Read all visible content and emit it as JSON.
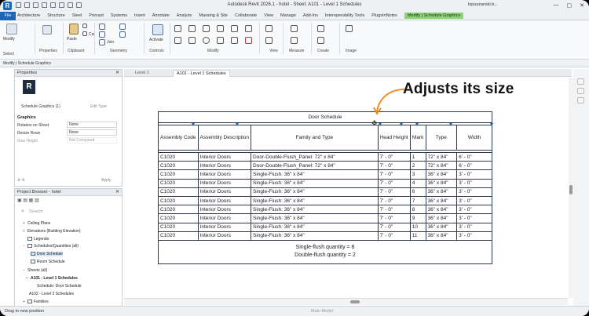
{
  "window": {
    "title": "Autodesk Revit 2026.1 - hotel - Sheet: A101 - Level 1 Schedules",
    "user": "lopuszanski.b...",
    "minimize": "—",
    "maximize": "▢",
    "close": "✕"
  },
  "menu": {
    "file": "File",
    "items": [
      "Architecture",
      "Structure",
      "Steel",
      "Precast",
      "Systems",
      "Insert",
      "Annotate",
      "Analyze",
      "Massing & Site",
      "Collaborate",
      "View",
      "Manage",
      "Add-Ins",
      "Interoperability Tools",
      "PlugsInNotes"
    ],
    "context_tab": "Modify | Schedule Graphics"
  },
  "ribbon": {
    "panels": [
      "Select",
      "Properties",
      "Clipboard",
      "Geometry",
      "Controls",
      "Modify",
      "View",
      "Measure",
      "Create",
      "Image"
    ],
    "modify_label": "Modify",
    "paste_label": "Paste",
    "cut_label": "Cut",
    "join_label": "Join",
    "activate_label": "Activate"
  },
  "options_bar": "Modify | Schedule Graphics",
  "properties": {
    "title": "Properties",
    "type_icon": "R",
    "type_selector": "Schedule Graphics (1)",
    "edit_type": "Edit Type",
    "section": "Graphics",
    "rows": [
      {
        "label": "Rotation on Sheet",
        "value": "None"
      },
      {
        "label": "Resize Rows",
        "value": "None"
      },
      {
        "label": "Row Height",
        "value": "Not Computed"
      }
    ],
    "apply": "Apply"
  },
  "project_browser": {
    "title": "Project Browser - hotel",
    "search_placeholder": "Search",
    "rows": [
      "Ceiling Plans",
      "Elevations (Building Elevation)",
      "Legends",
      "Schedules/Quantities (all)",
      "Door Schedule",
      "Room Schedule",
      "Sheets (all)",
      "A101 - Level 1 Schedules",
      "Schedule: Door Schedule",
      "A102 - Level 2 Schedules",
      "Families"
    ]
  },
  "view_tabs": [
    {
      "label": "Level 1"
    },
    {
      "label": "A101 - Level 1 Schedules"
    }
  ],
  "status": {
    "message": "Drag to new position",
    "model": "Main Model"
  },
  "annotation": "Adjusts its size",
  "schedule": {
    "title": "Door Schedule",
    "headers": [
      "Assembly Code",
      "Assembly Description",
      "Family and Type",
      "Head Height",
      "Mark",
      "Type",
      "Width"
    ],
    "rows": [
      [
        "C1020",
        "Interior Doors",
        "Door-Double-Flush_Panel: 72\" x 84\"",
        "7' - 0\"",
        "1",
        "72\" x 84\"",
        "6' - 0\""
      ],
      [
        "C1020",
        "Interior Doors",
        "Door-Double-Flush_Panel: 72\" x 84\"",
        "7' - 0\"",
        "2",
        "72\" x 84\"",
        "6' - 0\""
      ],
      [
        "C1020",
        "Interior Doors",
        "Single-Flush: 36\" x 84\"",
        "7' - 0\"",
        "3",
        "36\" x 84\"",
        "3' - 0\""
      ],
      [
        "C1020",
        "Interior Doors",
        "Single-Flush: 36\" x 84\"",
        "7' - 0\"",
        "4",
        "36\" x 84\"",
        "3' - 0\""
      ],
      [
        "C1020",
        "Interior Doors",
        "Single-Flush: 36\" x 84\"",
        "7' - 0\"",
        "6",
        "36\" x 84\"",
        "3' - 0\""
      ],
      [
        "C1020",
        "Interior Doors",
        "Single-Flush: 36\" x 84\"",
        "7' - 0\"",
        "7",
        "36\" x 84\"",
        "3' - 0\""
      ],
      [
        "C1020",
        "Interior Doors",
        "Single-Flush: 36\" x 84\"",
        "7' - 0\"",
        "8",
        "36\" x 84\"",
        "3' - 0\""
      ],
      [
        "C1020",
        "Interior Doors",
        "Single-Flush: 36\" x 84\"",
        "7' - 0\"",
        "9",
        "36\" x 84\"",
        "3' - 0\""
      ],
      [
        "C1020",
        "Interior Doors",
        "Single-Flush: 36\" x 84\"",
        "7' - 0\"",
        "10",
        "36\" x 84\"",
        "3' - 0\""
      ],
      [
        "C1020",
        "Interior Doors",
        "Single-Flush: 36\" x 84\"",
        "7' - 0\"",
        "11",
        "36\" x 84\"",
        "3' - 0\""
      ]
    ],
    "summary": [
      "Single-flush quantity = 8",
      "Double-flush quantity = 2"
    ]
  },
  "colors": {
    "accent": "#1a66b8",
    "context_tab": "#8fd17a",
    "grip": "#2a5db0",
    "arrow": "#e8902c"
  },
  "icons": [
    "revit-logo-icon",
    "move-cursor-icon",
    "curved-arrow-icon",
    "search-icon",
    "gear-icon"
  ]
}
